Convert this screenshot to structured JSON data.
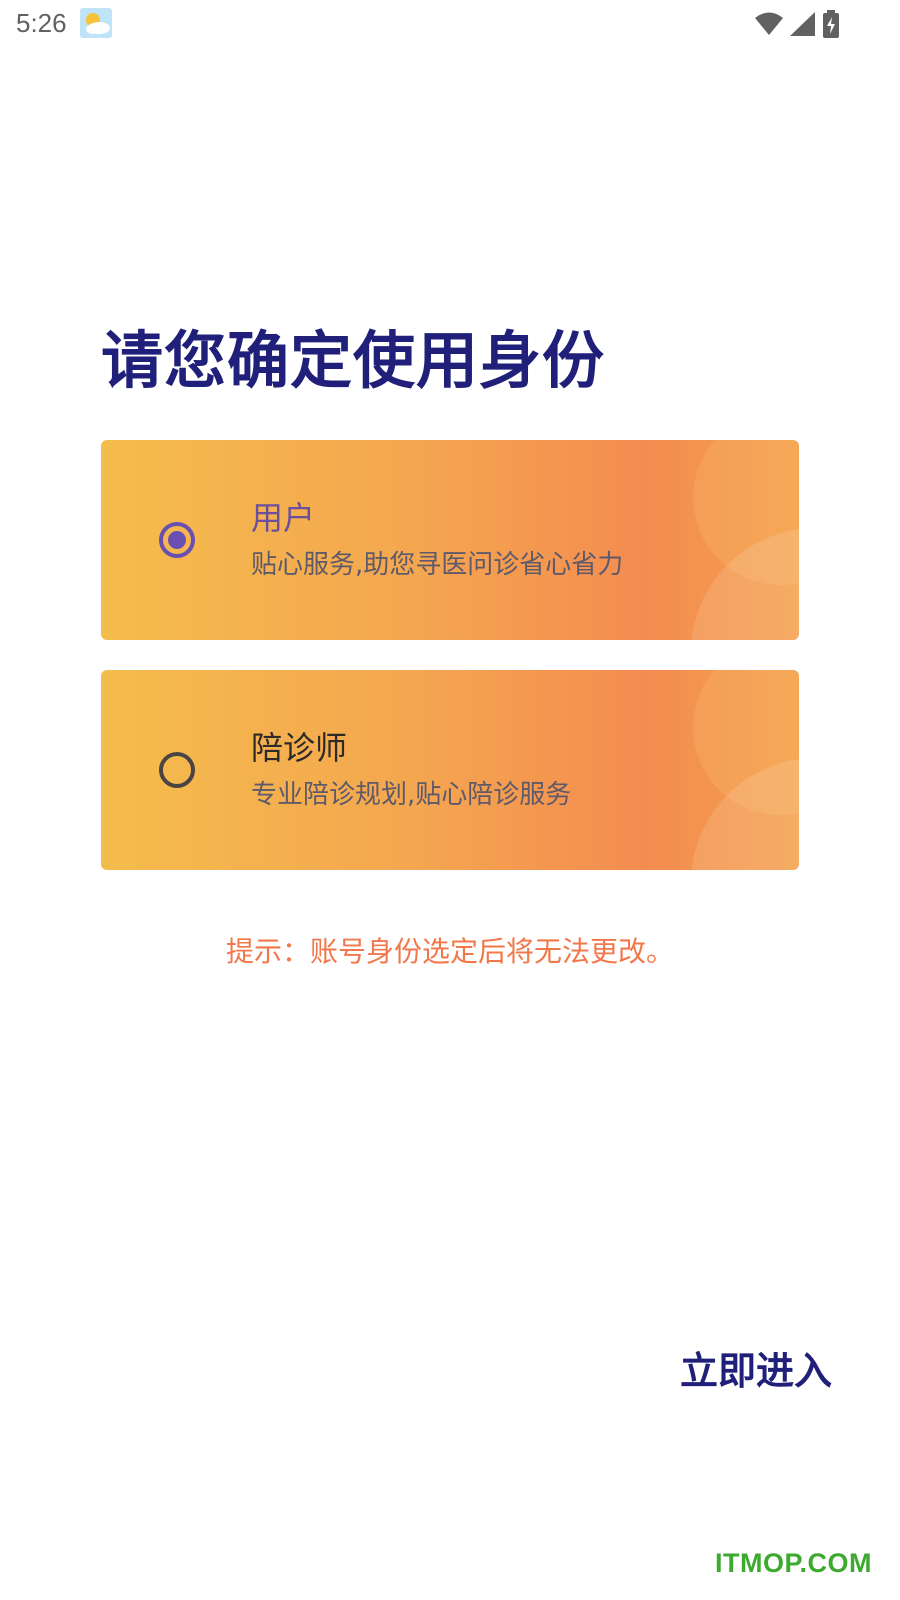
{
  "status_bar": {
    "time": "5:26",
    "icons": [
      "weather-icon",
      "wifi-icon",
      "signal-icon",
      "battery-charging-icon"
    ]
  },
  "title": "请您确定使用身份",
  "roles": [
    {
      "name": "用户",
      "description": "贴心服务,助您寻医问诊省心省力",
      "selected": true
    },
    {
      "name": "陪诊师",
      "description": "专业陪诊规划,贴心陪诊服务",
      "selected": false
    }
  ],
  "hint": "提示：账号身份选定后将无法更改。",
  "enter_button_label": "立即进入",
  "watermark": "ITMOP.COM",
  "colors": {
    "title": "#20207a",
    "card_gradient_start": "#f4bc4c",
    "card_gradient_end": "#f48c50",
    "radio_selected": "#6a4fb3",
    "hint": "#f2784b",
    "watermark": "#3daa2f"
  }
}
